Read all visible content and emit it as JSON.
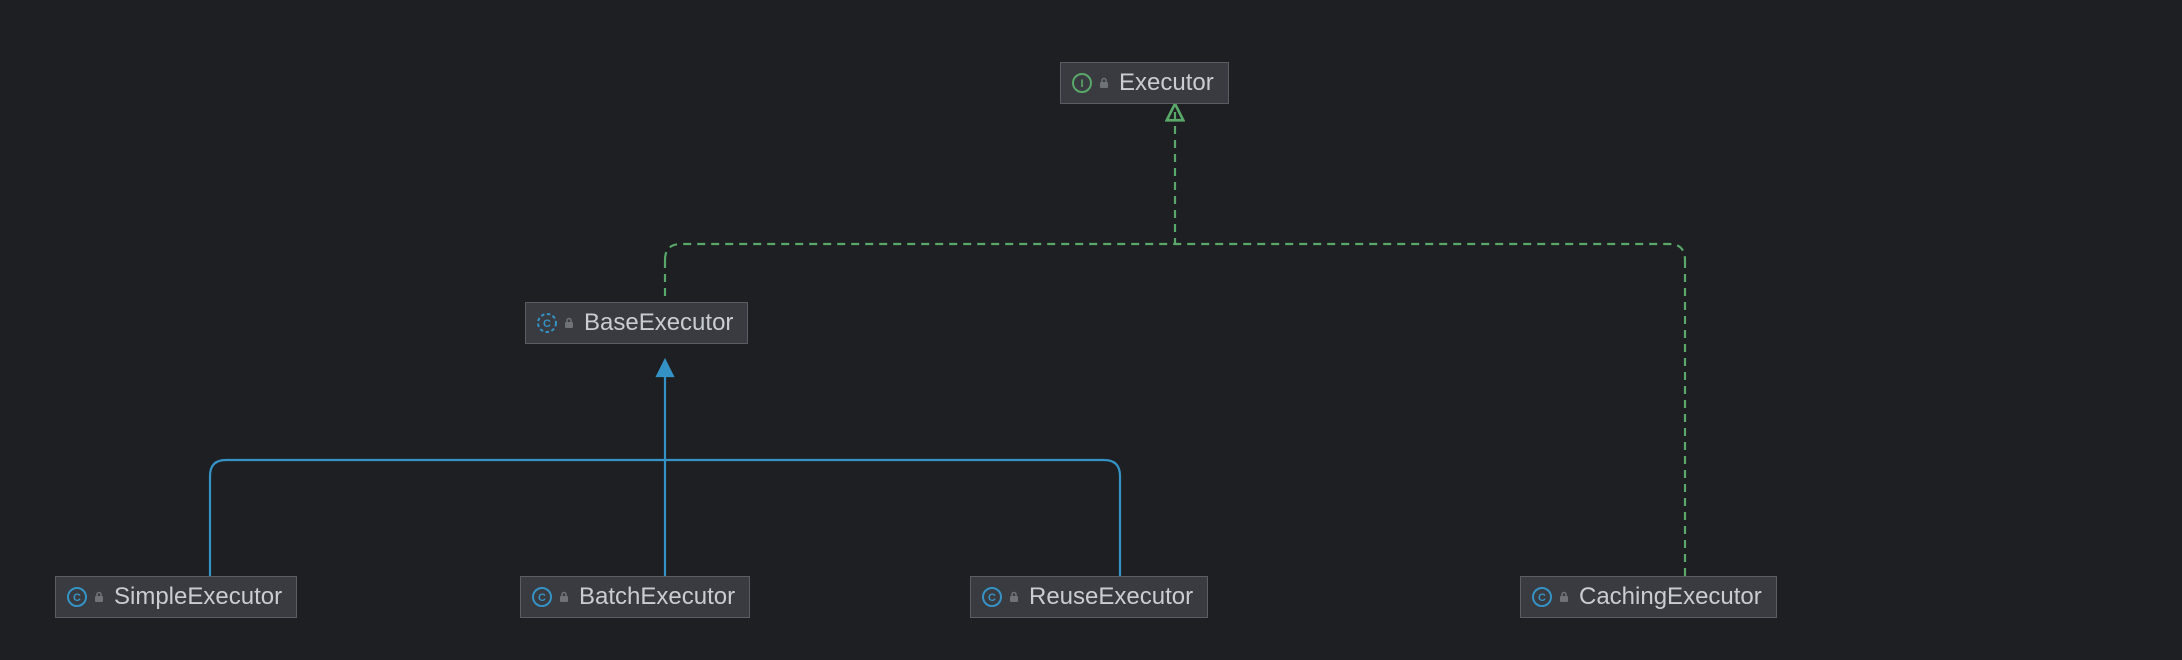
{
  "diagram": {
    "type": "class-hierarchy",
    "nodes": {
      "executor": {
        "name": "Executor",
        "kind": "interface"
      },
      "baseExecutor": {
        "name": "BaseExecutor",
        "kind": "class"
      },
      "simpleExecutor": {
        "name": "SimpleExecutor",
        "kind": "class"
      },
      "batchExecutor": {
        "name": "BatchExecutor",
        "kind": "class"
      },
      "reuseExecutor": {
        "name": "ReuseExecutor",
        "kind": "class"
      },
      "cachingExecutor": {
        "name": "CachingExecutor",
        "kind": "class"
      }
    },
    "edges": [
      {
        "from": "baseExecutor",
        "to": "executor",
        "relation": "implements"
      },
      {
        "from": "cachingExecutor",
        "to": "executor",
        "relation": "implements"
      },
      {
        "from": "simpleExecutor",
        "to": "baseExecutor",
        "relation": "extends"
      },
      {
        "from": "batchExecutor",
        "to": "baseExecutor",
        "relation": "extends"
      },
      {
        "from": "reuseExecutor",
        "to": "baseExecutor",
        "relation": "extends"
      }
    ],
    "colors": {
      "implements": "#59a869",
      "extends": "#3592c4",
      "interfaceIcon": "#59a869",
      "classIcon": "#3592c4",
      "lockIcon": "#6f7378",
      "nodeBg": "#393b40",
      "nodeBorder": "#5a5d63",
      "text": "#c9ccd1",
      "pageBg": "#1e1f22"
    }
  }
}
